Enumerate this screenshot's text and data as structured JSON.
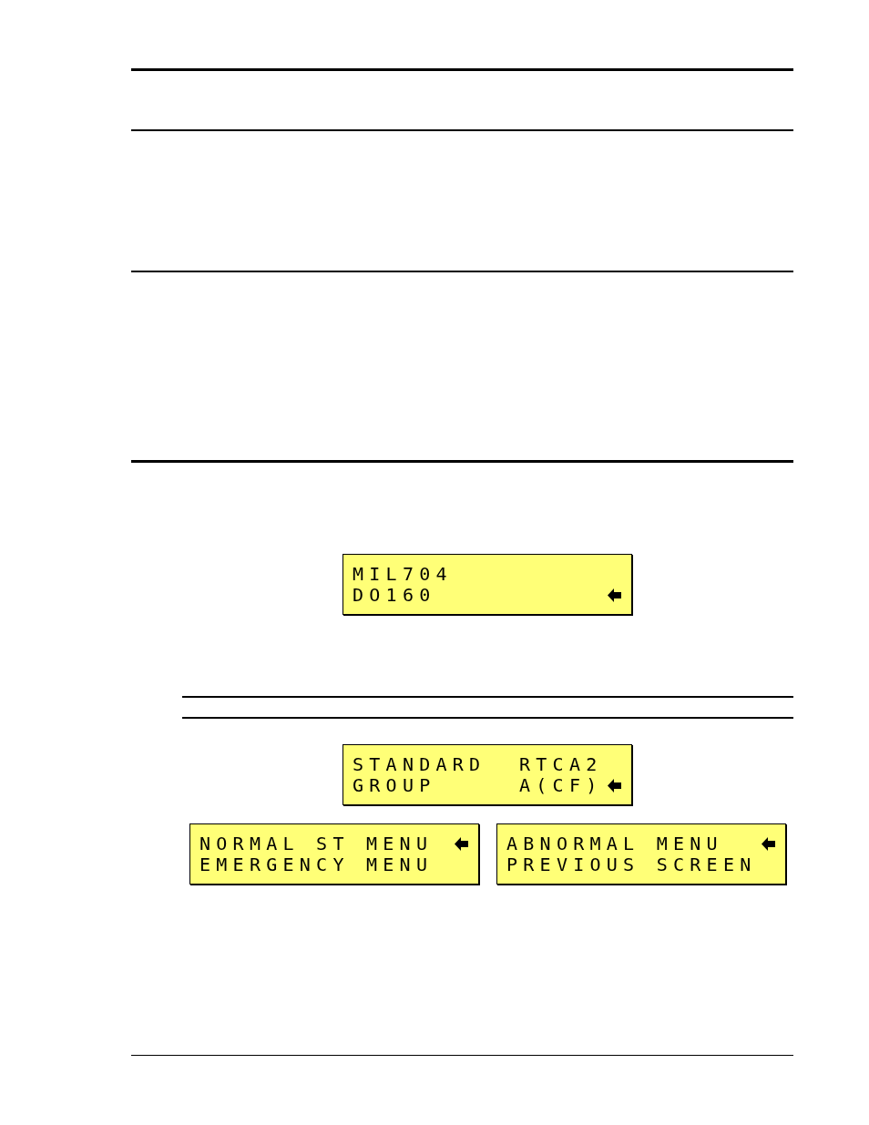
{
  "top_display": {
    "lines": [
      {
        "text": "MIL704",
        "selected": false
      },
      {
        "text": "DO160",
        "selected": true
      }
    ]
  },
  "menu_display": {
    "lines": [
      {
        "text": "STANDARD  RTCA2",
        "selected": false
      },
      {
        "text": "GROUP     A(CF)",
        "selected": true
      }
    ]
  },
  "option_displays": [
    {
      "lines": [
        {
          "text": "NORMAL ST MENU",
          "selected": true
        },
        {
          "text": "EMERGENCY MENU",
          "selected": false
        }
      ]
    },
    {
      "lines": [
        {
          "text": "ABNORMAL MENU",
          "selected": true
        },
        {
          "text": "PREVIOUS SCREEN",
          "selected": false
        }
      ]
    }
  ]
}
